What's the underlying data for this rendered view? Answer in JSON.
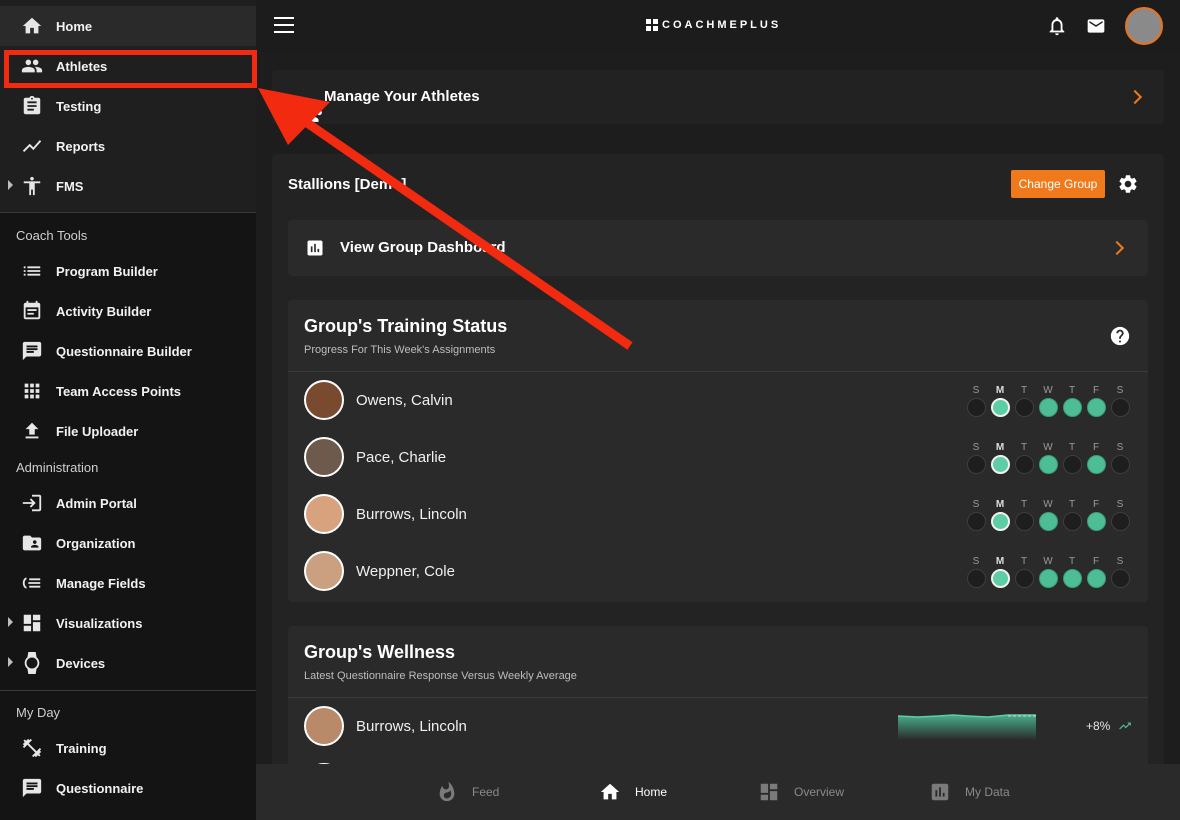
{
  "sidebar": {
    "nav_top": [
      {
        "label": "Home",
        "icon": "home-icon"
      },
      {
        "label": "Athletes",
        "icon": "athletes-icon"
      },
      {
        "label": "Testing",
        "icon": "clipboard-icon"
      },
      {
        "label": "Reports",
        "icon": "trending-icon"
      },
      {
        "label": "FMS",
        "icon": "figure-icon"
      }
    ],
    "coach_tools_title": "Coach Tools",
    "coach_tools": [
      {
        "label": "Program Builder",
        "icon": "list-icon"
      },
      {
        "label": "Activity Builder",
        "icon": "calendar-icon"
      },
      {
        "label": "Questionnaire Builder",
        "icon": "chat-icon"
      },
      {
        "label": "Team Access Points",
        "icon": "grid-icon"
      },
      {
        "label": "File Uploader",
        "icon": "upload-icon"
      }
    ],
    "administration_title": "Administration",
    "administration": [
      {
        "label": "Admin Portal",
        "icon": "login-icon"
      },
      {
        "label": "Organization",
        "icon": "folder-user-icon"
      },
      {
        "label": "Manage Fields",
        "icon": "fields-icon"
      },
      {
        "label": "Visualizations",
        "icon": "dashboard-icon"
      },
      {
        "label": "Devices",
        "icon": "watch-icon"
      }
    ],
    "my_day_title": "My Day",
    "my_day": [
      {
        "label": "Training",
        "icon": "dumbbell-icon"
      },
      {
        "label": "Questionnaire",
        "icon": "chat-icon"
      }
    ]
  },
  "topbar": {
    "brand": "COACHMEPLUS"
  },
  "main": {
    "manage_athletes_label": "Manage Your Athletes",
    "group_name": "Stallions [Demo]",
    "change_group_label": "Change Group",
    "view_dashboard_label": "View Group Dashboard",
    "training_status": {
      "title": "Group's Training Status",
      "subtitle": "Progress For This Week's Assignments",
      "days": [
        "S",
        "M",
        "T",
        "W",
        "T",
        "F",
        "S"
      ],
      "athletes": [
        {
          "name": "Owens, Calvin",
          "status": [
            0,
            2,
            0,
            1,
            1,
            1,
            0
          ]
        },
        {
          "name": "Pace, Charlie",
          "status": [
            0,
            2,
            0,
            1,
            0,
            1,
            0
          ]
        },
        {
          "name": "Burrows, Lincoln",
          "status": [
            0,
            2,
            0,
            1,
            0,
            1,
            0
          ]
        },
        {
          "name": "Weppner, Cole",
          "status": [
            0,
            2,
            0,
            1,
            1,
            1,
            0
          ]
        }
      ]
    },
    "wellness": {
      "title": "Group's Wellness",
      "subtitle": "Latest Questionnaire Response Versus Weekly Average",
      "rows": [
        {
          "name": "Burrows, Lincoln",
          "change": "+8%"
        }
      ]
    }
  },
  "bottomnav": {
    "items": [
      {
        "label": "Feed",
        "icon": "flame-icon"
      },
      {
        "label": "Home",
        "icon": "home-icon"
      },
      {
        "label": "Overview",
        "icon": "dashboard-icon"
      },
      {
        "label": "My Data",
        "icon": "bar-chart-icon"
      }
    ]
  },
  "colors": {
    "accent": "#f07a1b",
    "complete": "#4dbd95",
    "annotation": "#f22a10"
  }
}
